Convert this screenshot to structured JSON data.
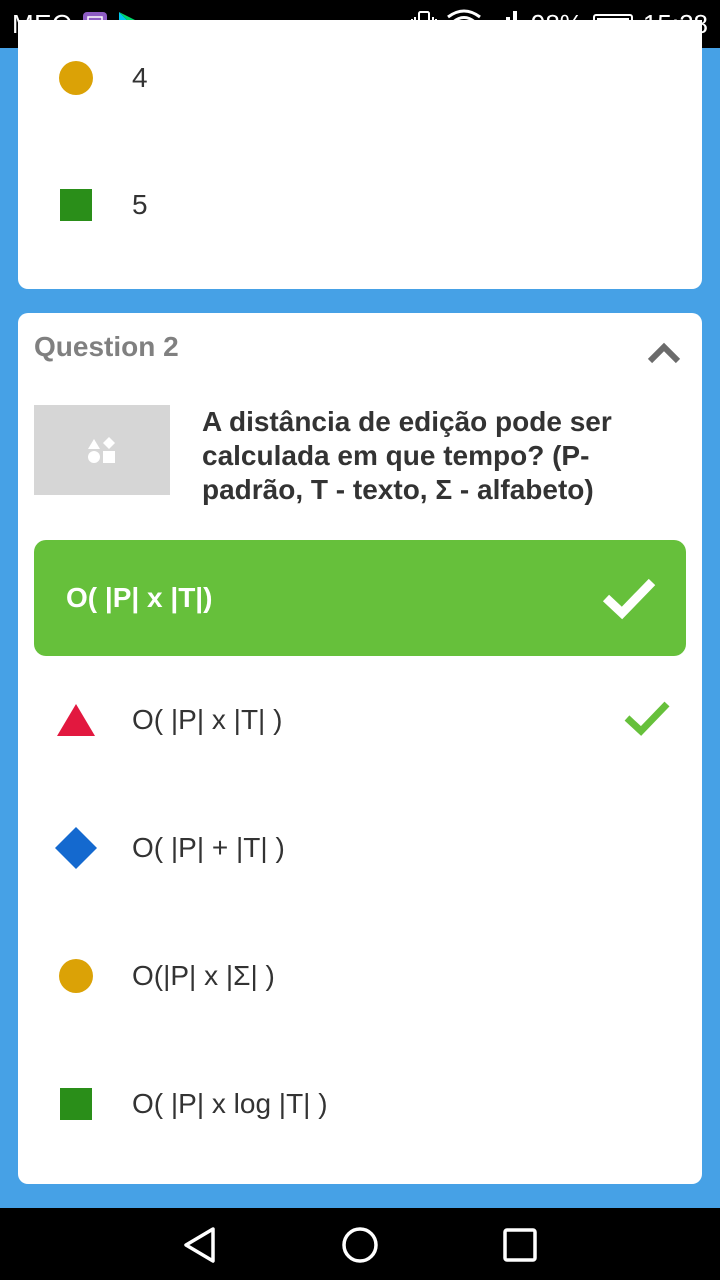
{
  "status_bar": {
    "carrier": "MEO",
    "battery": "98%",
    "time": "15:28",
    "icons": [
      "gallery-icon",
      "play-store-icon",
      "vibrate-icon",
      "wifi-icon",
      "signal-icon",
      "battery-icon"
    ]
  },
  "previous_card": {
    "options": [
      {
        "shape": "circle",
        "color": "#dba206",
        "label": "4"
      },
      {
        "shape": "square",
        "color": "#2a8e19",
        "label": "5"
      }
    ]
  },
  "question": {
    "header": "Question 2",
    "text": "A distância de edição pode ser calculada em que tempo? (P-padrão, T - texto, Σ - alfabeto)",
    "correct_answer": "O( |P| x |T|)",
    "options": [
      {
        "shape": "triangle",
        "color": "#e2183f",
        "label": "O( |P| x |T| )",
        "correct": true
      },
      {
        "shape": "diamond",
        "color": "#1469cf",
        "label": "O( |P| + |T| )",
        "correct": false
      },
      {
        "shape": "circle",
        "color": "#dba206",
        "label": "O(|P| x |Σ| )",
        "correct": false
      },
      {
        "shape": "square",
        "color": "#2a8e19",
        "label": "O( |P| x log |T| )",
        "correct": false
      }
    ]
  },
  "colors": {
    "background": "#46a1e6",
    "correct_green": "#66c03b",
    "header_gray": "#808080"
  },
  "nav_bar": {
    "icons": [
      "back-icon",
      "home-icon",
      "recents-icon"
    ]
  }
}
